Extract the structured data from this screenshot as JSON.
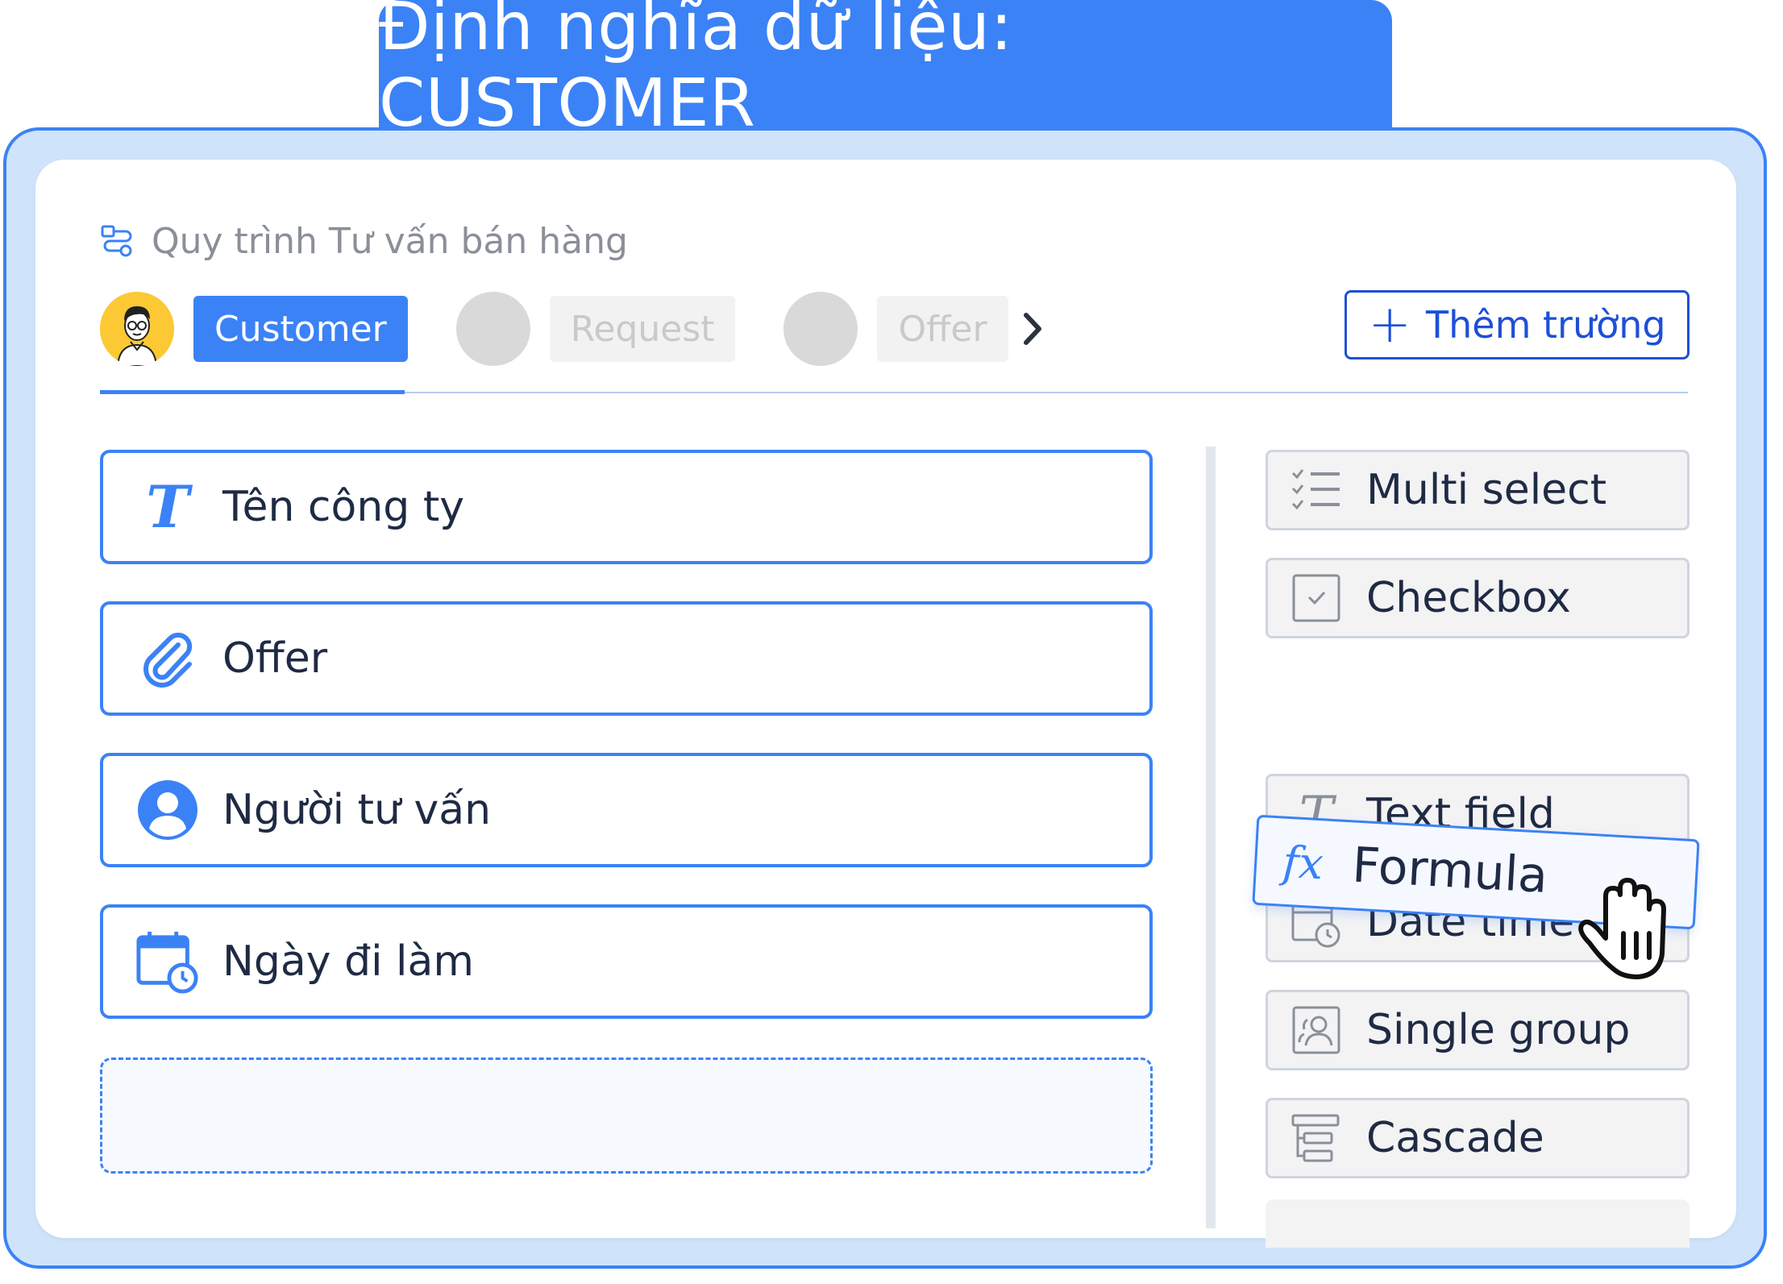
{
  "title": "Định nghĩa dữ liệu: CUSTOMER",
  "breadcrumb": "Quy trình Tư vấn bán hàng",
  "steps": {
    "active": "Customer",
    "step2": "Request",
    "step3": "Offer"
  },
  "add_field_button": "Thêm trường",
  "fields": [
    {
      "label": "Tên công ty",
      "icon": "text-icon"
    },
    {
      "label": "Offer",
      "icon": "attachment-icon"
    },
    {
      "label": "Người tư vấn",
      "icon": "user-icon"
    },
    {
      "label": "Ngày đi làm",
      "icon": "calendar-clock-icon"
    }
  ],
  "tools": [
    {
      "label": "Multi select",
      "icon": "checklist-icon"
    },
    {
      "label": "Checkbox",
      "icon": "checkbox-icon"
    },
    {
      "label": "Formula",
      "icon": "fx-icon",
      "symbol": "fx"
    },
    {
      "label": "Text field",
      "icon": "text-icon"
    },
    {
      "label": "Date time",
      "icon": "calendar-clock-icon"
    },
    {
      "label": "Single group",
      "icon": "group-icon"
    },
    {
      "label": "Cascade",
      "icon": "cascade-icon"
    }
  ],
  "colors": {
    "accent": "#3b82f6",
    "button_text": "#1e4fd8",
    "panel": "#cfe3fb"
  }
}
